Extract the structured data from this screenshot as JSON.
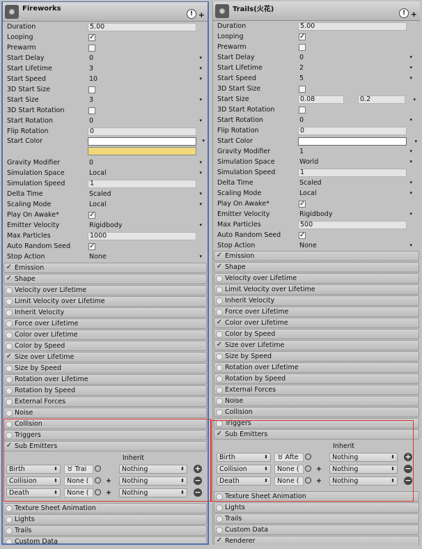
{
  "left": {
    "title": "Fireworks",
    "duration": "5.00",
    "looping": "✓",
    "prewarm": "",
    "start_delay": "0",
    "start_lifetime": "3",
    "start_speed": "10",
    "start_size_3d": "",
    "start_size": "3",
    "start_rotation_3d": "",
    "start_rotation": "0",
    "flip_rotation": "0",
    "gravity_modifier": "0",
    "simulation_space": "Local",
    "simulation_speed": "1",
    "delta_time": "Scaled",
    "scaling_mode": "Local",
    "play_on_awake": "✓",
    "emitter_velocity": "Rigidbody",
    "max_particles": "1000",
    "auto_random_seed": "✓",
    "stop_action": "None",
    "modules": [
      "Emission",
      "Shape",
      "Velocity over Lifetime",
      "Limit Velocity over Lifetime",
      "Inherit Velocity",
      "Force over Lifetime",
      "Color over Lifetime",
      "Color by Speed",
      "Size over Lifetime",
      "Size by Speed",
      "Rotation over Lifetime",
      "Rotation by Speed",
      "External Forces",
      "Noise",
      "Collision",
      "Triggers",
      "Sub Emitters"
    ],
    "sub_rows": [
      {
        "type": "Birth",
        "obj": "Trai",
        "inherit": "Nothing"
      },
      {
        "type": "Collision",
        "obj": "None (",
        "inherit": "Nothing"
      },
      {
        "type": "Death",
        "obj": "None (",
        "inherit": "Nothing"
      }
    ],
    "modules_after": [
      "Texture Sheet Animation",
      "Lights",
      "Trails",
      "Custom Data"
    ]
  },
  "right": {
    "title": "Trails(火花)",
    "duration": "5.00",
    "looping": "✓",
    "prewarm": "",
    "start_delay": "0",
    "start_lifetime": "2",
    "start_speed": "5",
    "start_size_3d": "",
    "start_size_a": "0.08",
    "start_size_b": "0.2",
    "start_rotation_3d": "",
    "start_rotation": "0",
    "flip_rotation": "0",
    "gravity_modifier": "1",
    "simulation_space": "World",
    "simulation_speed": "1",
    "delta_time": "Scaled",
    "scaling_mode": "Local",
    "play_on_awake": "✓",
    "emitter_velocity": "Rigidbody",
    "max_particles": "500",
    "auto_random_seed": "✓",
    "stop_action": "None",
    "modules": [
      "Emission",
      "Shape",
      "Velocity over Lifetime",
      "Limit Velocity over Lifetime",
      "Inherit Velocity",
      "Force over Lifetime",
      "Color over Lifetime",
      "Color by Speed",
      "Size over Lifetime",
      "Size by Speed",
      "Rotation over Lifetime",
      "Rotation by Speed",
      "External Forces",
      "Noise",
      "Collision",
      "Triggers",
      "Sub Emitters"
    ],
    "sub_rows": [
      {
        "type": "Birth",
        "obj": "Afte",
        "inherit": "Nothing"
      },
      {
        "type": "Collision",
        "obj": "None (",
        "inherit": "Nothing"
      },
      {
        "type": "Death",
        "obj": "None (",
        "inherit": "Nothing"
      }
    ],
    "modules_after": [
      "Texture Sheet Animation",
      "Lights",
      "Trails",
      "Custom Data",
      "Renderer"
    ]
  },
  "labels": {
    "duration": "Duration",
    "looping": "Looping",
    "prewarm": "Prewarm",
    "start_delay": "Start Delay",
    "start_lifetime": "Start Lifetime",
    "start_speed": "Start Speed",
    "start_size_3d": "3D Start Size",
    "start_size": "Start Size",
    "start_rotation_3d": "3D Start Rotation",
    "start_rotation": "Start Rotation",
    "flip_rotation": "Flip Rotation",
    "start_color": "Start Color",
    "gravity_modifier": "Gravity Modifier",
    "simulation_space": "Simulation Space",
    "simulation_speed": "Simulation Speed",
    "delta_time": "Delta Time",
    "scaling_mode": "Scaling Mode",
    "play_on_awake": "Play On Awake*",
    "emitter_velocity": "Emitter Velocity",
    "max_particles": "Max Particles",
    "auto_random_seed": "Auto Random Seed",
    "stop_action": "Stop Action",
    "inherit": "Inherit"
  },
  "colors": {
    "left_start_color_top": "#ffffff",
    "left_start_color_bar": "#efd97a",
    "right_start_color": "#ffffff",
    "highlight": "#e03030",
    "selection": "#4f6fae"
  },
  "enabled": {
    "left": [
      "Emission",
      "Shape",
      "Size over Lifetime",
      "Sub Emitters"
    ],
    "right": [
      "Emission",
      "Shape",
      "Color over Lifetime",
      "Size over Lifetime",
      "Sub Emitters",
      "Renderer"
    ]
  }
}
